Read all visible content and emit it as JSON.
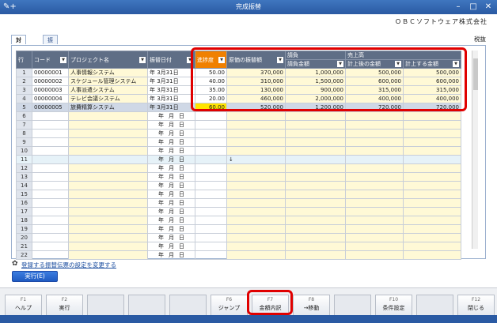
{
  "window": {
    "title": "完成振替",
    "app_icon": "✎+",
    "company": "ＯＢＣソフトウェア株式会社"
  },
  "tabs": [
    {
      "label": "対象一覧"
    },
    {
      "label": "振替伝票プレビュー"
    }
  ],
  "kubun_label": "税抜",
  "grid": {
    "headers": {
      "row": "行",
      "code": "コード",
      "project": "プロジェクト名",
      "date": "振替日付",
      "progress": "進捗度",
      "cost": "原価の振替額",
      "contract_group": "請負",
      "contract_amount": "請負金額",
      "sales_group": "売上高",
      "sales_posted": "計上後の金額",
      "sales_to_post": "計上する金額"
    },
    "date_parts": {
      "year": "年",
      "month": "月",
      "day": "日"
    },
    "rows": [
      {
        "n": "1",
        "code": "00000001",
        "project": "人事情報システム",
        "date": "年  3月31日",
        "progress": "50.00",
        "cost": "370,000",
        "contract": "1,000,000",
        "posted": "500,000",
        "topost": "500,000"
      },
      {
        "n": "2",
        "code": "00000002",
        "project": "スケジュール管理システム",
        "date": "年  3月31日",
        "progress": "40.00",
        "cost": "310,000",
        "contract": "1,500,000",
        "posted": "600,000",
        "topost": "600,000"
      },
      {
        "n": "3",
        "code": "00000003",
        "project": "人事派遣システム",
        "date": "年  3月31日",
        "progress": "35.00",
        "cost": "130,000",
        "contract": "900,000",
        "posted": "315,000",
        "topost": "315,000"
      },
      {
        "n": "4",
        "code": "00000004",
        "project": "テレビ会議システム",
        "date": "年  3月31日",
        "progress": "20.00",
        "cost": "460,000",
        "contract": "2,000,000",
        "posted": "400,000",
        "topost": "400,000"
      },
      {
        "n": "5",
        "code": "00000005",
        "project": "旅費精算システム",
        "date": "年  3月31日",
        "progress": "60.00",
        "cost": "520,000",
        "contract": "1,200,000",
        "posted": "720,000",
        "topost": "720,000"
      }
    ],
    "empty_rows": [
      "6",
      "7",
      "8",
      "9",
      "10",
      "11",
      "12",
      "13",
      "14",
      "15",
      "16",
      "17",
      "18",
      "19",
      "20",
      "21",
      "22"
    ],
    "cursor_mark": "↓"
  },
  "settings_link": "登録する振替伝票の設定を変更する",
  "run_button": "実行(E)",
  "fkeys": [
    {
      "key": "F1",
      "label": "ヘルプ"
    },
    {
      "key": "F2",
      "label": "実行"
    },
    {
      "key": "",
      "label": ""
    },
    {
      "key": "",
      "label": ""
    },
    {
      "key": "",
      "label": ""
    },
    {
      "key": "F6",
      "label": "ジャンプ"
    },
    {
      "key": "F7",
      "label": "金額内訳"
    },
    {
      "key": "F8",
      "label": "→移動"
    },
    {
      "key": "",
      "label": ""
    },
    {
      "key": "F10",
      "label": "条件設定"
    },
    {
      "key": "",
      "label": ""
    },
    {
      "key": "F12",
      "label": "閉じる"
    }
  ],
  "colors": {
    "highlight_orange": "#f08000",
    "selected_yellow": "#ffe400",
    "annotation_red": "#e00000"
  }
}
